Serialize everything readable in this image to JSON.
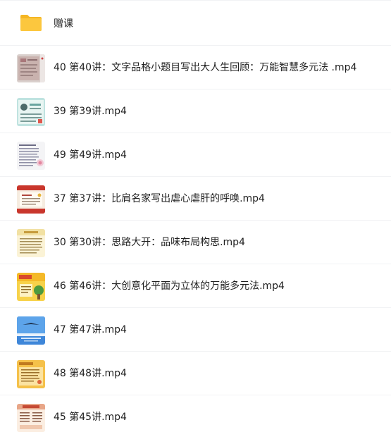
{
  "files": [
    {
      "name": "赠课",
      "icon": "folder-icon"
    },
    {
      "name": "40 第40讲：文字品格小题目写出大人生回顾：万能智慧多元法 .mp4",
      "icon": "video-thumbnail"
    },
    {
      "name": "39 第39讲.mp4",
      "icon": "video-thumbnail"
    },
    {
      "name": "49 第49讲.mp4",
      "icon": "video-thumbnail"
    },
    {
      "name": "37 第37讲：比肩名家写出虐心虐肝的呼唤.mp4",
      "icon": "video-thumbnail"
    },
    {
      "name": "30 第30讲：思路大开：品味布局构思.mp4",
      "icon": "video-thumbnail"
    },
    {
      "name": "46 第46讲：大创意化平面为立体的万能多元法.mp4",
      "icon": "video-thumbnail"
    },
    {
      "name": "47 第47讲.mp4",
      "icon": "video-thumbnail"
    },
    {
      "name": "48 第48讲.mp4",
      "icon": "video-thumbnail"
    },
    {
      "name": "45 第45讲.mp4",
      "icon": "video-thumbnail"
    }
  ],
  "colors": {
    "folder": "#fcc02d",
    "text": "#1f1f1f",
    "divider": "#f1f2f4"
  }
}
